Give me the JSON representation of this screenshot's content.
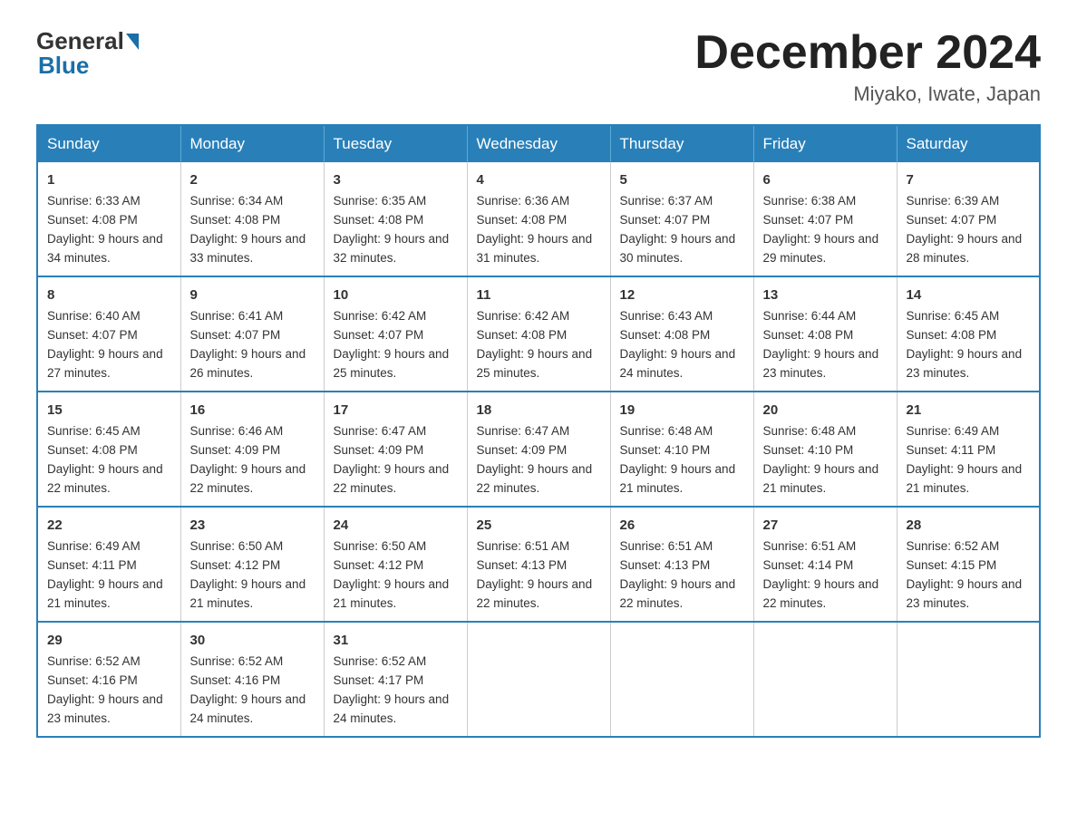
{
  "header": {
    "logo_general": "General",
    "logo_blue": "Blue",
    "month_title": "December 2024",
    "location": "Miyako, Iwate, Japan"
  },
  "days_of_week": [
    "Sunday",
    "Monday",
    "Tuesday",
    "Wednesday",
    "Thursday",
    "Friday",
    "Saturday"
  ],
  "weeks": [
    [
      {
        "day": "1",
        "sunrise": "6:33 AM",
        "sunset": "4:08 PM",
        "daylight": "9 hours and 34 minutes."
      },
      {
        "day": "2",
        "sunrise": "6:34 AM",
        "sunset": "4:08 PM",
        "daylight": "9 hours and 33 minutes."
      },
      {
        "day": "3",
        "sunrise": "6:35 AM",
        "sunset": "4:08 PM",
        "daylight": "9 hours and 32 minutes."
      },
      {
        "day": "4",
        "sunrise": "6:36 AM",
        "sunset": "4:08 PM",
        "daylight": "9 hours and 31 minutes."
      },
      {
        "day": "5",
        "sunrise": "6:37 AM",
        "sunset": "4:07 PM",
        "daylight": "9 hours and 30 minutes."
      },
      {
        "day": "6",
        "sunrise": "6:38 AM",
        "sunset": "4:07 PM",
        "daylight": "9 hours and 29 minutes."
      },
      {
        "day": "7",
        "sunrise": "6:39 AM",
        "sunset": "4:07 PM",
        "daylight": "9 hours and 28 minutes."
      }
    ],
    [
      {
        "day": "8",
        "sunrise": "6:40 AM",
        "sunset": "4:07 PM",
        "daylight": "9 hours and 27 minutes."
      },
      {
        "day": "9",
        "sunrise": "6:41 AM",
        "sunset": "4:07 PM",
        "daylight": "9 hours and 26 minutes."
      },
      {
        "day": "10",
        "sunrise": "6:42 AM",
        "sunset": "4:07 PM",
        "daylight": "9 hours and 25 minutes."
      },
      {
        "day": "11",
        "sunrise": "6:42 AM",
        "sunset": "4:08 PM",
        "daylight": "9 hours and 25 minutes."
      },
      {
        "day": "12",
        "sunrise": "6:43 AM",
        "sunset": "4:08 PM",
        "daylight": "9 hours and 24 minutes."
      },
      {
        "day": "13",
        "sunrise": "6:44 AM",
        "sunset": "4:08 PM",
        "daylight": "9 hours and 23 minutes."
      },
      {
        "day": "14",
        "sunrise": "6:45 AM",
        "sunset": "4:08 PM",
        "daylight": "9 hours and 23 minutes."
      }
    ],
    [
      {
        "day": "15",
        "sunrise": "6:45 AM",
        "sunset": "4:08 PM",
        "daylight": "9 hours and 22 minutes."
      },
      {
        "day": "16",
        "sunrise": "6:46 AM",
        "sunset": "4:09 PM",
        "daylight": "9 hours and 22 minutes."
      },
      {
        "day": "17",
        "sunrise": "6:47 AM",
        "sunset": "4:09 PM",
        "daylight": "9 hours and 22 minutes."
      },
      {
        "day": "18",
        "sunrise": "6:47 AM",
        "sunset": "4:09 PM",
        "daylight": "9 hours and 22 minutes."
      },
      {
        "day": "19",
        "sunrise": "6:48 AM",
        "sunset": "4:10 PM",
        "daylight": "9 hours and 21 minutes."
      },
      {
        "day": "20",
        "sunrise": "6:48 AM",
        "sunset": "4:10 PM",
        "daylight": "9 hours and 21 minutes."
      },
      {
        "day": "21",
        "sunrise": "6:49 AM",
        "sunset": "4:11 PM",
        "daylight": "9 hours and 21 minutes."
      }
    ],
    [
      {
        "day": "22",
        "sunrise": "6:49 AM",
        "sunset": "4:11 PM",
        "daylight": "9 hours and 21 minutes."
      },
      {
        "day": "23",
        "sunrise": "6:50 AM",
        "sunset": "4:12 PM",
        "daylight": "9 hours and 21 minutes."
      },
      {
        "day": "24",
        "sunrise": "6:50 AM",
        "sunset": "4:12 PM",
        "daylight": "9 hours and 21 minutes."
      },
      {
        "day": "25",
        "sunrise": "6:51 AM",
        "sunset": "4:13 PM",
        "daylight": "9 hours and 22 minutes."
      },
      {
        "day": "26",
        "sunrise": "6:51 AM",
        "sunset": "4:13 PM",
        "daylight": "9 hours and 22 minutes."
      },
      {
        "day": "27",
        "sunrise": "6:51 AM",
        "sunset": "4:14 PM",
        "daylight": "9 hours and 22 minutes."
      },
      {
        "day": "28",
        "sunrise": "6:52 AM",
        "sunset": "4:15 PM",
        "daylight": "9 hours and 23 minutes."
      }
    ],
    [
      {
        "day": "29",
        "sunrise": "6:52 AM",
        "sunset": "4:16 PM",
        "daylight": "9 hours and 23 minutes."
      },
      {
        "day": "30",
        "sunrise": "6:52 AM",
        "sunset": "4:16 PM",
        "daylight": "9 hours and 24 minutes."
      },
      {
        "day": "31",
        "sunrise": "6:52 AM",
        "sunset": "4:17 PM",
        "daylight": "9 hours and 24 minutes."
      },
      {
        "day": "",
        "sunrise": "",
        "sunset": "",
        "daylight": ""
      },
      {
        "day": "",
        "sunrise": "",
        "sunset": "",
        "daylight": ""
      },
      {
        "day": "",
        "sunrise": "",
        "sunset": "",
        "daylight": ""
      },
      {
        "day": "",
        "sunrise": "",
        "sunset": "",
        "daylight": ""
      }
    ]
  ],
  "labels": {
    "sunrise": "Sunrise:",
    "sunset": "Sunset:",
    "daylight": "Daylight:"
  }
}
